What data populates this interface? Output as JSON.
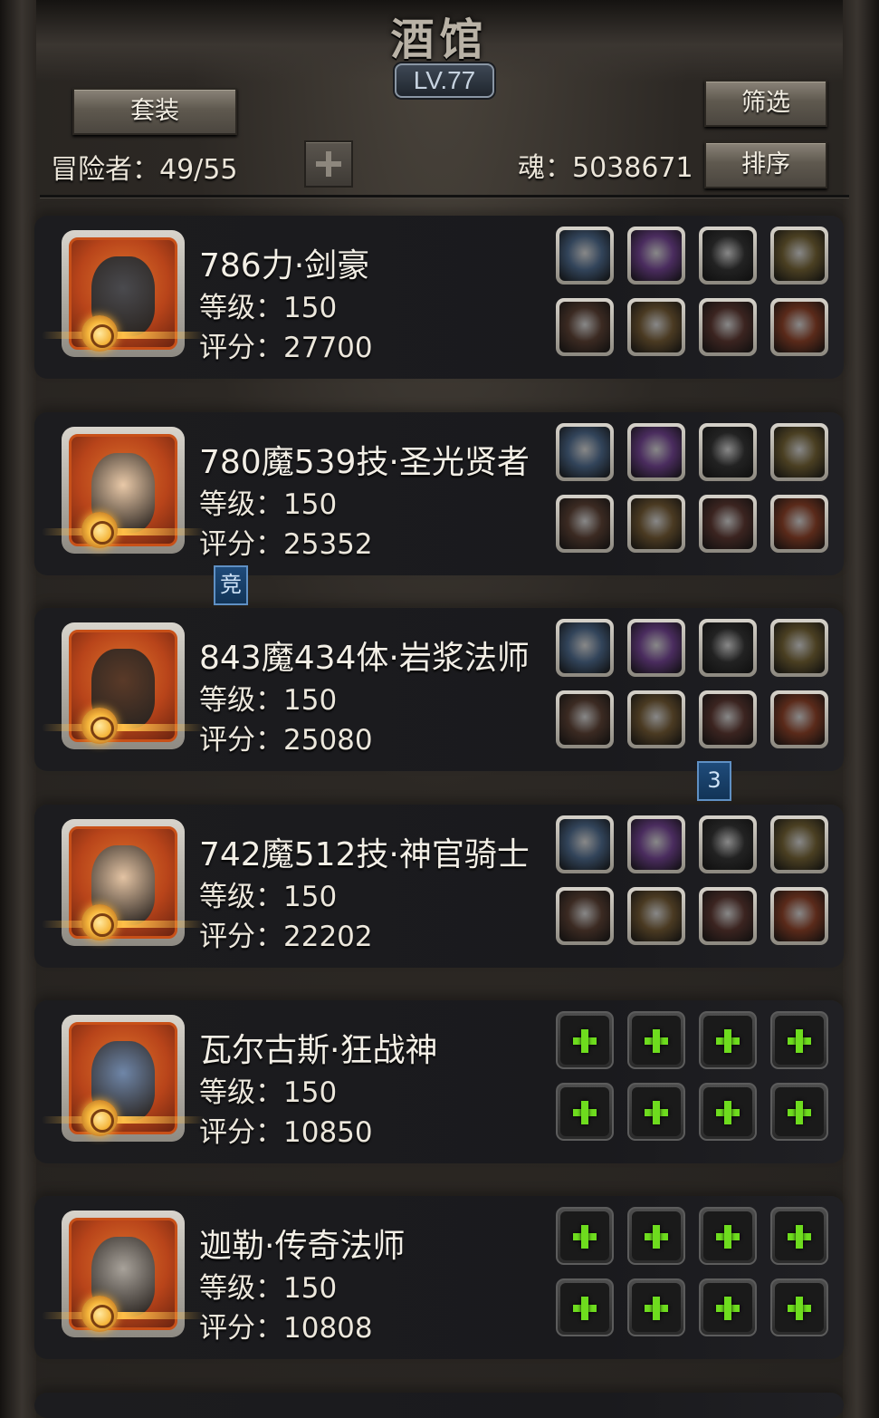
{
  "header": {
    "title": "酒馆",
    "level": "LV.77",
    "set_button": "套装",
    "filter_button": "筛选",
    "sort_button": "排序",
    "adventurer_label": "冒险者：49/55",
    "soul_label": "魂：5038671"
  },
  "level_prefix": "等级：",
  "score_prefix": "评分：",
  "markers": {
    "arena": "竞",
    "count": "3"
  },
  "colors": {
    "frame": "#2a2622",
    "card": "#1c1c1f",
    "portrait_bg": "#c85018",
    "add_slot_plus": "#6edc1e"
  },
  "heroes": [
    {
      "name": "786力·剑豪",
      "level": "等级：150",
      "score": "评分：27700",
      "portrait_icon": "iron-helmet-knight",
      "slots": [
        "cloud-ring-icon",
        "purple-gem-icon",
        "spear-icon",
        "gold-medallion-icon",
        "blue-sword-icon",
        "chest-armor-icon",
        "belt-icon",
        "demon-mask-icon"
      ],
      "empty": false
    },
    {
      "name": "780魔539技·圣光贤者",
      "level": "等级：150",
      "score": "评分：25352",
      "portrait_icon": "nun-portrait",
      "slots": [
        "cloud-ring-icon",
        "red-orb-icon",
        "purple-crystal-icon",
        "blue-vase-icon",
        "mace-icon",
        "chest-armor-icon",
        "red-pendant-icon",
        "gold-ring-icon"
      ],
      "empty": false
    },
    {
      "name": "843魔434体·岩浆法师",
      "level": "等级：150",
      "score": "评分：25080",
      "portrait_icon": "warrior-man-portrait",
      "slots": [
        "cloud-ring-icon",
        "dark-orb-icon",
        "silver-shield-icon",
        "jade-stone-icon",
        "staff-icon",
        "chest-armor-icon",
        "amulet-icon",
        "rune-sigil-icon"
      ],
      "empty": false
    },
    {
      "name": "742魔512技·神官骑士",
      "level": "等级：150",
      "score": "评分：22202",
      "portrait_icon": "priestess-portrait",
      "slots": [
        "cloud-ring-icon",
        "gauntlet-icon",
        "lantern-icon",
        "dagger-icon",
        "scepter-icon",
        "purple-armor-icon",
        "triangle-crest-icon",
        "knight-helm-icon"
      ],
      "empty": false
    },
    {
      "name": "瓦尔古斯·狂战神",
      "level": "等级：150",
      "score": "评分：10850",
      "portrait_icon": "blue-beast-portrait",
      "slots": [],
      "empty": true
    },
    {
      "name": "迦勒·传奇法师",
      "level": "等级：150",
      "score": "评分：10808",
      "portrait_icon": "old-wizard-portrait",
      "slots": [],
      "empty": true
    }
  ]
}
